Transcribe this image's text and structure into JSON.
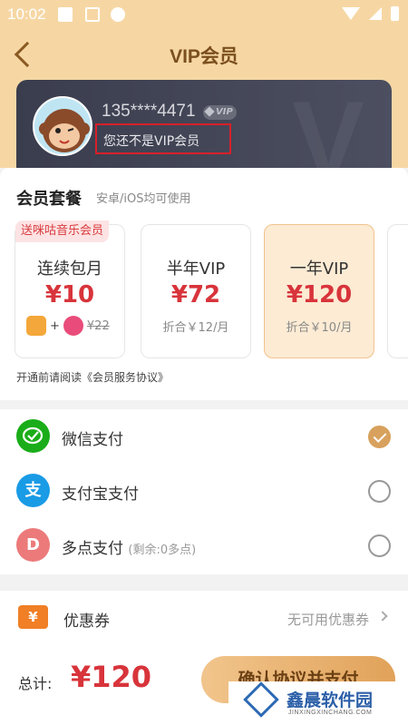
{
  "status_bar": {
    "time": "10:02"
  },
  "header": {
    "title": "VIP会员"
  },
  "profile": {
    "phone": "135****4471",
    "vip_badge": "VIP",
    "status_text": "您还不是VIP会员"
  },
  "plans": {
    "title": "会员套餐",
    "subtitle": "安卓/iOS均可使用",
    "items": [
      {
        "tag": "送咪咕音乐会员",
        "name": "连续包月",
        "price": "¥10",
        "original_price": "¥22"
      },
      {
        "name": "半年VIP",
        "price": "¥72",
        "note": "折合￥12/月"
      },
      {
        "name": "一年VIP",
        "price": "¥120",
        "note": "折合￥10/月",
        "selected": true
      }
    ],
    "agreement": "开通前请阅读《会员服务协议》"
  },
  "payment": {
    "methods": [
      {
        "label": "微信支付",
        "icon": "wechat-pay-icon",
        "color": "#1aad19",
        "selected": true
      },
      {
        "label": "支付宝支付",
        "icon": "alipay-icon",
        "color": "#1a9be6",
        "selected": false
      },
      {
        "label": "多点支付",
        "extra": "(剩余:0多点)",
        "icon": "duodian-icon",
        "icon_text": "D",
        "color": "#ec7a7a",
        "selected": false
      }
    ]
  },
  "coupon": {
    "label": "优惠券",
    "value": "无可用优惠券",
    "icon": "coupon-icon",
    "icon_text": "¥"
  },
  "footer": {
    "total_label": "总计:",
    "total_value": "¥120",
    "pay_button": "确认协议并支付",
    "watermark": "鑫晨软件园",
    "watermark_url": "JINXINGXINCHANG.COM"
  },
  "colors": {
    "accent": "#d8343b",
    "header_bg": "#f6d7a4",
    "gold": "#d8a15d"
  }
}
